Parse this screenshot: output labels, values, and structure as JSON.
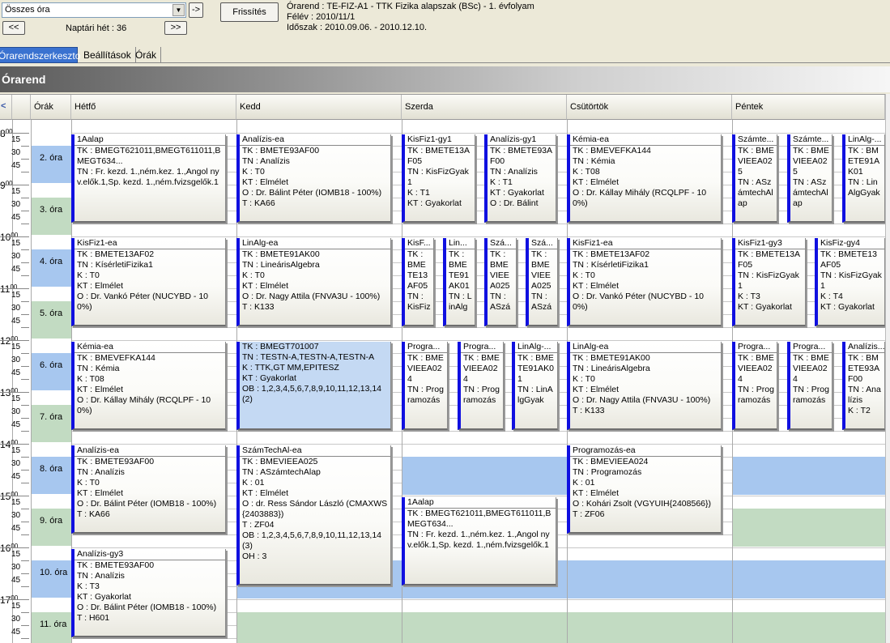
{
  "toolbar": {
    "view_select": "Összes óra",
    "go_label": "->",
    "refresh_label": "Frissítés",
    "prev_label": "<<",
    "next_label": ">>",
    "week_label": "Naptári hét : 36"
  },
  "header": {
    "line1": "Órarend : TE-FIZ-A1 - TTK Fizika alapszak (BSc) - 1. évfolyam",
    "line2": "Félév : 2010/11/1",
    "line3": "Időszak : 2010.09.06. - 2010.12.10."
  },
  "tabs": [
    "Órarendszerkeszto",
    "Beállítások",
    "Órák"
  ],
  "banner": "Órarend",
  "columns": {
    "orak": "Órák",
    "mon": "Hétfő",
    "tue": "Kedd",
    "wed": "Szerda",
    "thu": "Csütörtök",
    "fri": "Péntek"
  },
  "hours": [
    "8",
    "9",
    "10",
    "11",
    "12",
    "13",
    "14",
    "15",
    "16",
    "17"
  ],
  "hours_sup": "00",
  "minutes": [
    "15",
    "30",
    "45"
  ],
  "periods": [
    "2. óra",
    "3. óra",
    "4. óra",
    "5. óra",
    "6. óra",
    "7. óra",
    "8. óra",
    "9. óra",
    "10. óra",
    "11. óra"
  ],
  "cards": [
    {
      "title": "1Aalap",
      "lines": [
        "TK : BMEGT621011,BMEGT611011,BMEGT634...",
        "TN : Fr. kezd. 1.,ném.kez. 1.,Angol nyv.elők.1,Sp. kezd. 1.,ném.fvizsgelők.1"
      ]
    },
    {
      "title": "Analízis-ea",
      "lines": [
        "TK : BMETE93AF00",
        "TN : Analízis",
        "K : T0",
        "KT : Elmélet",
        "O : Dr. Bálint Péter (IOMB18 - 100%)",
        "T : KA66"
      ]
    },
    {
      "title": "KisFiz1-gy1",
      "lines": [
        "TK : BMETE13AF05",
        "TN : KisFizGyak1",
        "K : T1",
        "KT : Gyakorlat"
      ]
    },
    {
      "title": "Analízis-gy1",
      "lines": [
        "TK : BMETE93AF00",
        "TN : Analízis",
        "K : T1",
        "KT : Gyakorlat",
        "O : Dr. Bálint"
      ]
    },
    {
      "title": "Kémia-ea",
      "lines": [
        "TK : BMEVEFKA144",
        "TN : Kémia",
        "K : T08",
        "KT : Elmélet",
        "O : Dr. Kállay Mihály (RCQLPF - 100%)"
      ]
    },
    {
      "title": "Számte...",
      "lines": [
        "TK : BMEVIEEA025",
        "TN : ASzámtechAlap"
      ]
    },
    {
      "title": "Számte...",
      "lines": [
        "TK : BMEVIEEA025",
        "TN : ASzámtechAlap"
      ]
    },
    {
      "title": "LinAlg-...",
      "lines": [
        "TK : BMETE91AK01",
        "TN : LinAlgGyak"
      ]
    },
    {
      "title": "KisFiz1-ea",
      "lines": [
        "TK : BMETE13AF02",
        "TN : KísérletiFizika1",
        "K : T0",
        "KT : Elmélet",
        "O : Dr. Vankó Péter (NUCYBD - 100%)"
      ]
    },
    {
      "title": "LinAlg-ea",
      "lines": [
        "TK : BMETE91AK00",
        "TN : LineárisAlgebra",
        "K : T0",
        "KT : Elmélet",
        "O : Dr. Nagy Attila (FNVA3U - 100%)",
        "T : K133"
      ]
    },
    {
      "title": "KisF...",
      "lines": [
        "TK : BMETE13AF05",
        "TN : KisFiz"
      ]
    },
    {
      "title": "Lin...",
      "lines": [
        "TK : BMETE91AK01",
        "TN : LinAlg"
      ]
    },
    {
      "title": "Szá...",
      "lines": [
        "TK : BMEVIEEA025",
        "TN : ASzá"
      ]
    },
    {
      "title": "Szá...",
      "lines": [
        "TK : BMEVIEEA025",
        "TN : ASzá"
      ]
    },
    {
      "title": "KisFiz1-ea",
      "lines": [
        "TK : BMETE13AF02",
        "TN : KísérletiFizika1",
        "K : T0",
        "KT : Elmélet",
        "O : Dr. Vankó Péter (NUCYBD - 100%)"
      ]
    },
    {
      "title": "KisFiz1-gy3",
      "lines": [
        "TK : BMETE13AF05",
        "TN : KisFizGyak1",
        "K : T3",
        "KT : Gyakorlat"
      ]
    },
    {
      "title": "KisFiz-gy4",
      "lines": [
        "TK : BMETE13AF05",
        "TN : KisFizGyak1",
        "K : T4",
        "KT : Gyakorlat"
      ]
    },
    {
      "title": "Kémia-ea",
      "lines": [
        "TK : BMEVEFKA144",
        "TN : Kémia",
        "K : T08",
        "KT : Elmélet",
        "O : Dr. Kállay Mihály (RCQLPF - 100%)"
      ]
    },
    {
      "title": "",
      "lines": [
        "TK : BMEGT701007",
        "TN : TESTN-A,TESTN-A,TESTN-A",
        "K : TTK,GT MM,EPITESZ",
        "KT : Gyakorlat",
        "OB : 1,2,3,4,5,6,7,8,9,10,11,12,13,14 (2)"
      ]
    },
    {
      "title": "Progra...",
      "lines": [
        "TK : BMEVIEEA024",
        "TN : Programozás"
      ]
    },
    {
      "title": "Progra...",
      "lines": [
        "TK : BMEVIEEA024",
        "TN : Programozás"
      ]
    },
    {
      "title": "LinAlg-...",
      "lines": [
        "TK : BMETE91AK01",
        "TN : LinAlgGyak"
      ]
    },
    {
      "title": "LinAlg-ea",
      "lines": [
        "TK : BMETE91AK00",
        "TN : LineárisAlgebra",
        "K : T0",
        "KT : Elmélet",
        "O : Dr. Nagy Attila (FNVA3U - 100%)",
        "T : K133"
      ]
    },
    {
      "title": "Progra...",
      "lines": [
        "TK : BMEVIEEA024",
        "TN : Programozás"
      ]
    },
    {
      "title": "Progra...",
      "lines": [
        "TK : BMEVIEEA024",
        "TN : Programozás"
      ]
    },
    {
      "title": "Analízis...",
      "lines": [
        "TK : BMETE93AF00",
        "TN : Analízis",
        "K : T2"
      ]
    },
    {
      "title": "Analízis-ea",
      "lines": [
        "TK : BMETE93AF00",
        "TN : Analízis",
        "K : T0",
        "KT : Elmélet",
        "O : Dr. Bálint Péter (IOMB18 - 100%)",
        "T : KA66"
      ]
    },
    {
      "title": "SzámTechAl-ea",
      "lines": [
        "TK : BMEVIEEA025",
        "TN : ASzámtechAlap",
        "K : 01",
        "KT : Elmélet",
        "O : dr. Ress Sándor László (CMAXWS{2403883})",
        "T : ZF04",
        "OB : 1,2,3,4,5,6,7,8,9,10,11,12,13,14 (3)",
        "OH : 3"
      ]
    },
    {
      "title": "Programozás-ea",
      "lines": [
        "TK : BMEVIEEA024",
        "TN : Programozás",
        "K : 01",
        "KT : Elmélet",
        "O : Kohári Zsolt (VGYUIH{2408566})",
        "T : ZF06"
      ]
    },
    {
      "title": "1Aalap",
      "lines": [
        "TK : BMEGT621011,BMEGT611011,BMEGT634...",
        "TN : Fr. kezd. 1.,ném.kez. 1.,Angol nyv.elők.1,Sp. kezd. 1.,ném.fvizsgelők.1"
      ]
    },
    {
      "title": "Analízis-gy3",
      "lines": [
        "TK : BMETE93AF00",
        "TN : Analízis",
        "K : T3",
        "KT : Gyakorlat",
        "O : Dr. Bálint Péter (IOMB18 - 100%)",
        "T : H601"
      ]
    }
  ]
}
